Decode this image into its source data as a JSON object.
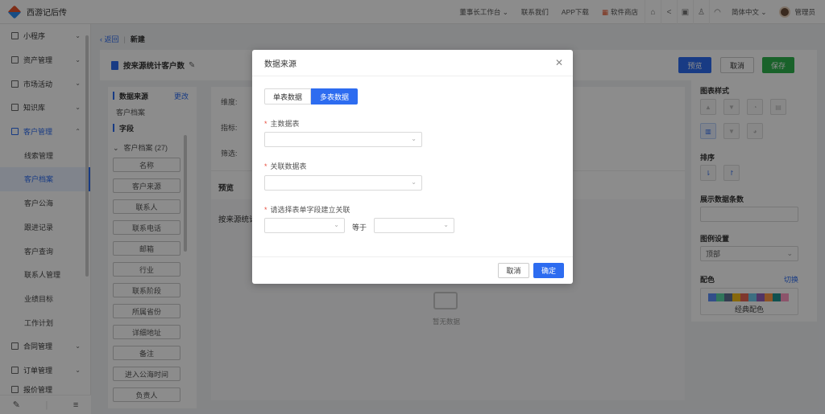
{
  "app": {
    "name": "西游记后传"
  },
  "topbar": {
    "workbench": "董事长工作台",
    "contact": "联系我们",
    "app_download": "APP下载",
    "store": "软件商店",
    "language": "简体中文",
    "user": "管理员"
  },
  "sidebar": {
    "items": [
      {
        "label": "小程序"
      },
      {
        "label": "资产管理"
      },
      {
        "label": "市场活动"
      },
      {
        "label": "知识库"
      },
      {
        "label": "客户管理"
      }
    ],
    "subitems": [
      {
        "label": "线索管理"
      },
      {
        "label": "客户档案"
      },
      {
        "label": "客户公海"
      },
      {
        "label": "跟进记录"
      },
      {
        "label": "客户查询"
      },
      {
        "label": "联系人管理"
      },
      {
        "label": "业绩目标"
      },
      {
        "label": "工作计划"
      }
    ],
    "items_after": [
      {
        "label": "合同管理"
      },
      {
        "label": "订单管理"
      },
      {
        "label": "报价管理"
      }
    ]
  },
  "breadcrumb": {
    "back": "返回",
    "current": "新建"
  },
  "page": {
    "title": "按来源统计客户数"
  },
  "toolbar": {
    "preview": "预览",
    "cancel": "取消",
    "save": "保存"
  },
  "left_panel": {
    "data_source_title": "数据来源",
    "change": "更改",
    "source_name": "客户档案",
    "fields_title": "字段",
    "tree_node": "客户档案 (27)",
    "fields": [
      "名称",
      "客户来源",
      "联系人",
      "联系电话",
      "邮箱",
      "行业",
      "联系阶段",
      "所属省份",
      "详细地址",
      "备注",
      "进入公海时间",
      "负责人"
    ]
  },
  "center_panel": {
    "dimension": "维度:",
    "metric": "指标:",
    "filter": "筛选:",
    "preview": "预览",
    "chart_title_partial": "按来源统计",
    "empty": "暂无数据"
  },
  "right_panel": {
    "chart_style": "图表样式",
    "sort": "排序",
    "show_count": "展示数据条数",
    "legend_settings": "图例设置",
    "legend_value": "顶部",
    "palette": "配色",
    "switch": "切换",
    "palette_name": "经典配色",
    "swatches": [
      "#5b8ff9",
      "#5ad8a6",
      "#5d7092",
      "#f6bd16",
      "#e86452",
      "#6dc8ec",
      "#945fb9",
      "#ff9845",
      "#1e9493",
      "#ff99c3",
      "#5b8ff9",
      "#cdddfd"
    ]
  },
  "modal": {
    "title": "数据来源",
    "tab_single": "单表数据",
    "tab_multi": "多表数据",
    "main_table_label": "主数据表",
    "related_table_label": "关联数据表",
    "join_label": "请选择表单字段建立关联",
    "equals": "等于",
    "cancel": "取消",
    "ok": "确定"
  }
}
